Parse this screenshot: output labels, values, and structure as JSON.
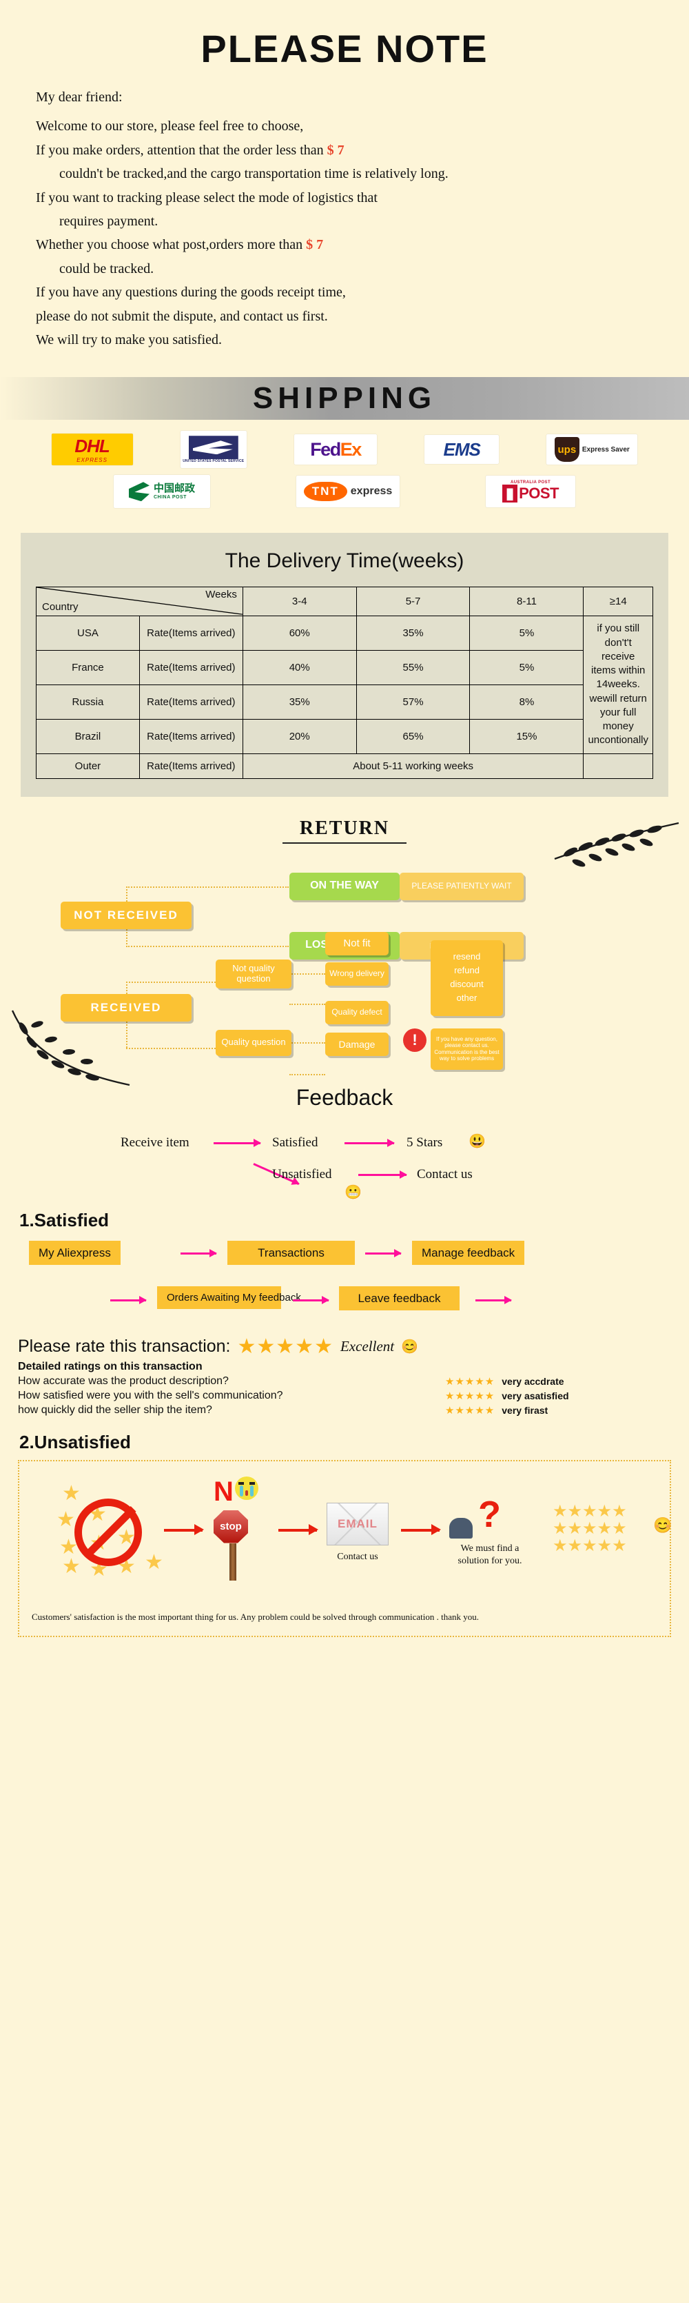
{
  "note": {
    "title": "PLEASE NOTE",
    "greeting": "My dear friend:",
    "lines": [
      "Welcome to our store, please feel free to choose,",
      "If you make orders, attention that the order less than",
      "couldn't be tracked,and the cargo transportation time is relatively long.",
      "If you want to tracking please select the mode of logistics that",
      "requires payment.",
      "Whether you choose what post,orders more than",
      "could be tracked.",
      "If you have any questions during the goods receipt time,",
      "please do not submit the dispute, and contact us first.",
      "We will try to make you satisfied."
    ],
    "price_label": "$ 7"
  },
  "shipping": {
    "banner": "SHIPPING",
    "carriers": [
      {
        "name": "DHL",
        "sub": "EXPRESS"
      },
      {
        "name": "USPS",
        "sub": "UNITED STATES POSTAL SERVICE"
      },
      {
        "name": "FedEx",
        "sub": ""
      },
      {
        "name": "EMS",
        "sub": ""
      },
      {
        "name": "UPS",
        "sub": "Express Saver"
      },
      {
        "name": "CHINA POST",
        "sub": "CHINA POST"
      },
      {
        "name": "TNT",
        "sub": "express"
      },
      {
        "name": "AUSTRALIA POST",
        "sub": "POST"
      }
    ]
  },
  "delivery": {
    "title": "The Delivery Time(weeks)",
    "corner_row": "Country",
    "corner_col": "Weeks",
    "columns": [
      "3-4",
      "5-7",
      "8-11",
      "≥14"
    ],
    "rate_label": "Rate(Items arrived)",
    "rows": [
      {
        "country": "USA",
        "rate": "Rate(Items arrived)",
        "values": [
          "60%",
          "35%",
          "5%"
        ]
      },
      {
        "country": "France",
        "rate": "Rate(Items arrived)",
        "values": [
          "40%",
          "55%",
          "5%"
        ]
      },
      {
        "country": "Russia",
        "rate": "Rate(Items arrived)",
        "values": [
          "35%",
          "57%",
          "8%"
        ]
      },
      {
        "country": "Brazil",
        "rate": "Rate(Items arrived)",
        "values": [
          "20%",
          "65%",
          "15%"
        ]
      }
    ],
    "outer_row": {
      "country": "Outer",
      "rate": "Rate(Items arrived)",
      "text": "About 5-11 working weeks"
    },
    "note": "if you still don't't receive items within 14weeks. wewill return your full money uncontionally"
  },
  "returns": {
    "title": "RETURN",
    "not_received": "NOT RECEIVED",
    "received": "RECEIVED",
    "on_the_way": "ON THE WAY",
    "on_the_way_note": "PLEASE PATIENTLY WAIT",
    "lost_return": "LOST/RETURN",
    "lost_return_note": "resend/refund",
    "not_quality": "Not quality question",
    "quality": "Quality question",
    "not_fit": "Not fit",
    "wrong_delivery": "Wrong delivery",
    "quality_defect": "Quality defect",
    "damage": "Damage",
    "options": [
      "resend",
      "refund",
      "discount",
      "other"
    ],
    "warning": "If you have any question, please contact us. Communication is the best way to solve problems"
  },
  "feedback": {
    "title": "Feedback",
    "receive_item": "Receive item",
    "satisfied": "Satisfied",
    "unsatisfied": "Unsatisfied",
    "five_stars": "5 Stars",
    "contact_us": "Contact us"
  },
  "satisfied": {
    "heading": "1.Satisfied",
    "steps_row1": [
      "My Aliexpress",
      "Transactions",
      "Manage feedback"
    ],
    "steps_row2": [
      "Orders Awaiting My feedback",
      "Leave feedback"
    ]
  },
  "rating": {
    "prompt": "Please rate this transaction:",
    "stars": "★★★★★",
    "excellent": "Excellent",
    "emoji": "😊",
    "detailed_heading": "Detailed ratings on this transaction",
    "rows": [
      {
        "question": "How accurate was the product description?",
        "stars": "★★★★★",
        "verdict": "very accdrate"
      },
      {
        "question": "How satisfied were you with the sell's communication?",
        "stars": "★★★★★",
        "verdict": "very asatisfied"
      },
      {
        "question": "how quickly did the seller ship the item?",
        "stars": "★★★★★",
        "verdict": "very firast"
      }
    ]
  },
  "unsatisfied": {
    "heading": "2.Unsatisfied",
    "no_label": "N",
    "stop_label": "stop",
    "email_label": "EMAIL",
    "contact_caption": "Contact us",
    "solution_caption": "We must find a solution for you.",
    "footer": "Customers' satisfaction is the most important thing for us. Any problem could be solved through communication . thank you."
  }
}
